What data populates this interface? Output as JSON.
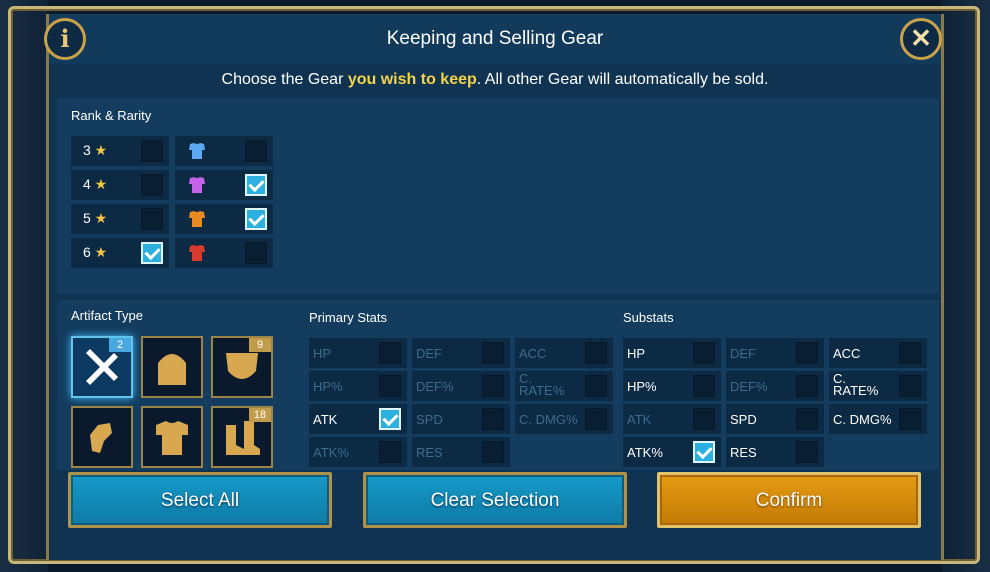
{
  "dialog": {
    "title": "Keeping and Selling Gear",
    "subtitle_pre": "Choose the Gear ",
    "subtitle_highlight": "you wish to keep",
    "subtitle_post": ". All other Gear will automatically be sold.",
    "info_icon": "i",
    "close_icon": "✕"
  },
  "rank_rarity": {
    "label": "Rank & Rarity",
    "ranks": [
      {
        "rank": "3",
        "checked": false
      },
      {
        "rank": "4",
        "checked": false
      },
      {
        "rank": "5",
        "checked": false
      },
      {
        "rank": "6",
        "checked": true
      }
    ],
    "rarities": [
      {
        "color": "#5aa9f2",
        "icon": "blue-chestplate-icon",
        "checked": false
      },
      {
        "color": "#c563e8",
        "icon": "purple-chestplate-icon",
        "checked": true
      },
      {
        "color": "#e98b23",
        "icon": "orange-chestplate-icon",
        "checked": true
      },
      {
        "color": "#d83b2e",
        "icon": "red-chestplate-icon",
        "checked": false
      }
    ]
  },
  "artifact_type": {
    "label": "Artifact Type",
    "items": [
      {
        "icon": "weapon-icon",
        "badge": "2",
        "selected": true
      },
      {
        "icon": "helmet-icon",
        "badge": "",
        "selected": false
      },
      {
        "icon": "shield-icon",
        "badge": "9",
        "selected": false
      },
      {
        "icon": "gauntlets-icon",
        "badge": "",
        "selected": false
      },
      {
        "icon": "chestplate-icon",
        "badge": "",
        "selected": false
      },
      {
        "icon": "boots-icon",
        "badge": "18",
        "selected": false
      }
    ]
  },
  "primary_stats": {
    "label": "Primary Stats",
    "items": [
      {
        "name": "HP",
        "enabled": false,
        "checked": false
      },
      {
        "name": "DEF",
        "enabled": false,
        "checked": false
      },
      {
        "name": "ACC",
        "enabled": false,
        "checked": false
      },
      {
        "name": "HP%",
        "enabled": false,
        "checked": false
      },
      {
        "name": "DEF%",
        "enabled": false,
        "checked": false
      },
      {
        "name": "C. RATE%",
        "enabled": false,
        "checked": false
      },
      {
        "name": "ATK",
        "enabled": true,
        "checked": true
      },
      {
        "name": "SPD",
        "enabled": false,
        "checked": false
      },
      {
        "name": "C. DMG%",
        "enabled": false,
        "checked": false
      },
      {
        "name": "ATK%",
        "enabled": false,
        "checked": false
      },
      {
        "name": "RES",
        "enabled": false,
        "checked": false
      }
    ]
  },
  "substats": {
    "label": "Substats",
    "items": [
      {
        "name": "HP",
        "enabled": true,
        "checked": false
      },
      {
        "name": "DEF",
        "enabled": false,
        "checked": false
      },
      {
        "name": "ACC",
        "enabled": true,
        "checked": false
      },
      {
        "name": "HP%",
        "enabled": true,
        "checked": false
      },
      {
        "name": "DEF%",
        "enabled": false,
        "checked": false
      },
      {
        "name": "C. RATE%",
        "enabled": true,
        "checked": false
      },
      {
        "name": "ATK",
        "enabled": false,
        "checked": false
      },
      {
        "name": "SPD",
        "enabled": true,
        "checked": false
      },
      {
        "name": "C. DMG%",
        "enabled": true,
        "checked": false
      },
      {
        "name": "ATK%",
        "enabled": true,
        "checked": true
      },
      {
        "name": "RES",
        "enabled": true,
        "checked": false
      }
    ]
  },
  "buttons": {
    "select_all": "Select All",
    "clear_selection": "Clear Selection",
    "confirm": "Confirm"
  }
}
